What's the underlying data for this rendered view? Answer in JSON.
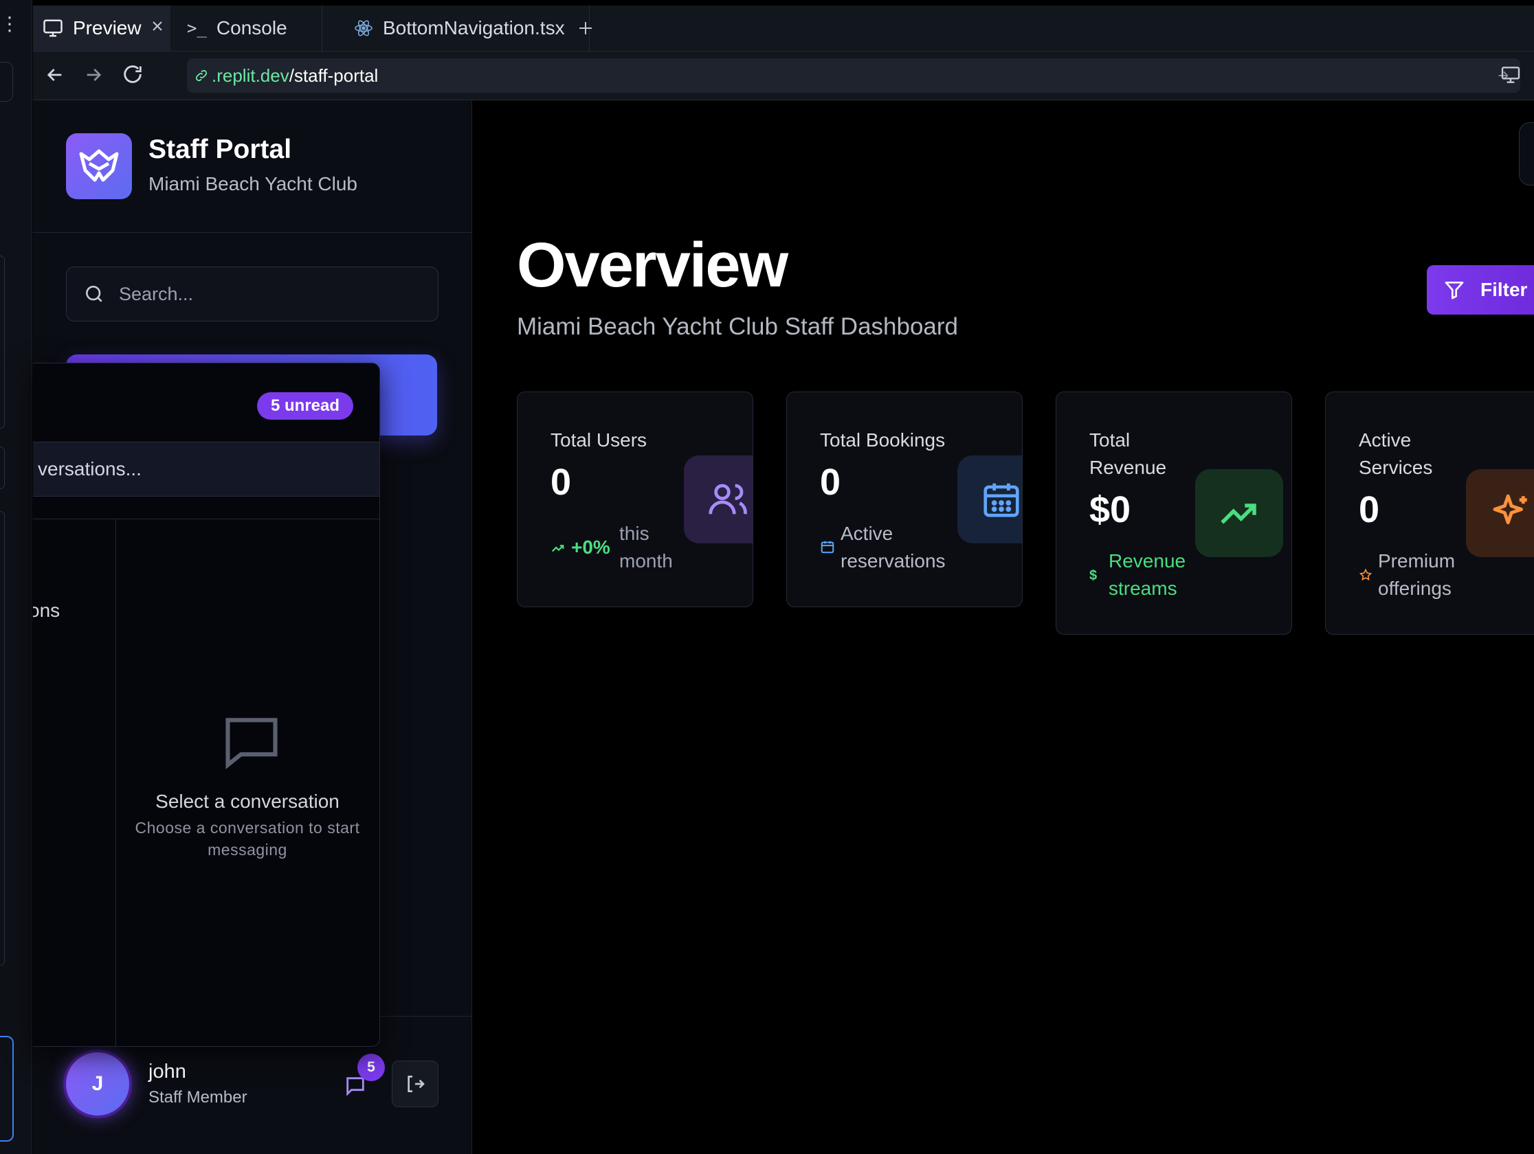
{
  "ide": {
    "tabs": [
      {
        "label": "Preview",
        "icon": "monitor-icon",
        "active": true
      },
      {
        "label": "Console",
        "icon": "terminal-icon"
      },
      {
        "label": "BottomNavigation.tsx",
        "icon": "react-icon"
      }
    ],
    "url": {
      "host": ".replit.dev",
      "path": "/staff-portal"
    }
  },
  "sidebar": {
    "brand_title": "Staff Portal",
    "brand_subtitle": "Miami Beach Yacht Club",
    "search_placeholder": "Search...",
    "user": {
      "initial": "J",
      "name": "john",
      "role": "Staff Member",
      "message_count": "5"
    }
  },
  "messages_panel": {
    "unread_badge": "5 unread",
    "search_placeholder_visible": "versations...",
    "list_partial_text": "ons",
    "empty_title": "Select a conversation",
    "empty_subtitle": "Choose a conversation to start messaging"
  },
  "main": {
    "title": "Overview",
    "subtitle": "Miami Beach Yacht Club Staff Dashboard",
    "filter_label": "Filter",
    "cards": [
      {
        "title": "Total Users",
        "value": "0",
        "trend": "+0%",
        "note": "this month",
        "icon": "users-icon",
        "accent": "#a78bfa"
      },
      {
        "title": "Total Bookings",
        "value": "0",
        "note": "Active reservations",
        "icon": "calendar-icon",
        "accent": "#60a5fa"
      },
      {
        "title_lines": [
          "Total",
          "Revenue"
        ],
        "value": "$0",
        "note": "Revenue streams",
        "icon": "trending-up-icon",
        "accent": "#4ade80"
      },
      {
        "title_lines": [
          "Active",
          "Services"
        ],
        "value": "0",
        "note": "Premium offerings",
        "icon": "sparkles-icon",
        "accent": "#fb923c"
      }
    ]
  }
}
